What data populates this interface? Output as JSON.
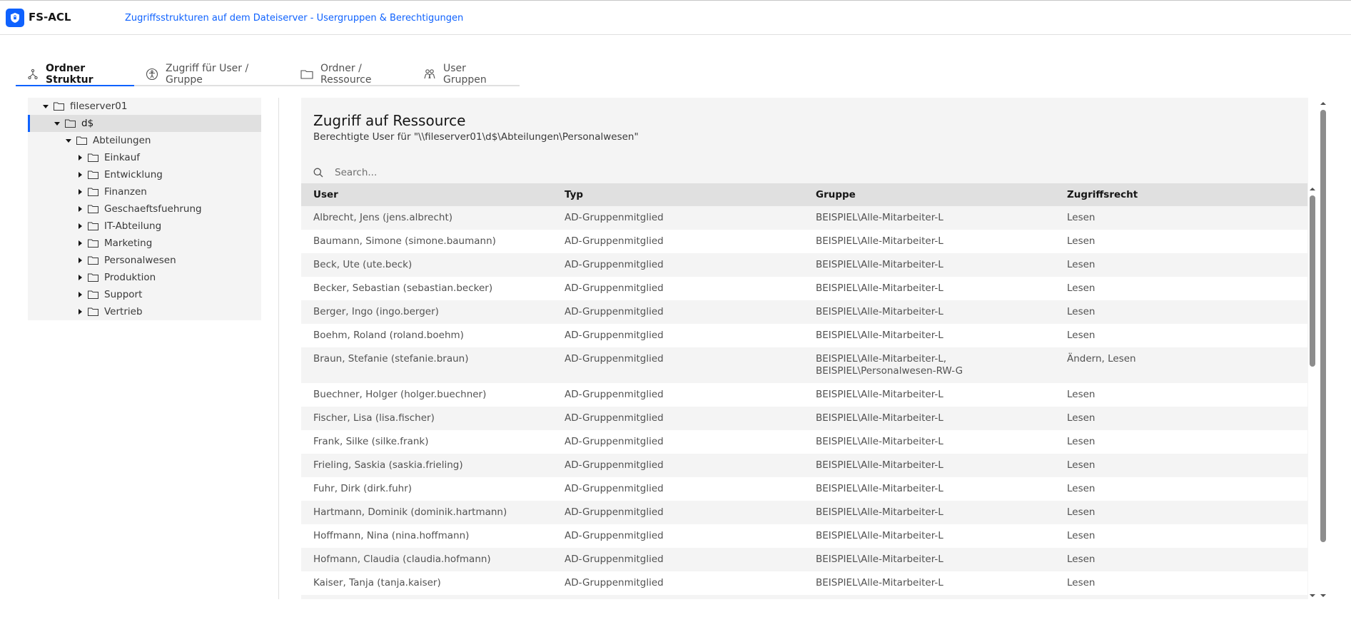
{
  "header": {
    "app_name": "FS-ACL",
    "subtitle": "Zugriffsstrukturen auf dem Dateiserver - Usergruppen & Berechtigungen",
    "brand_color": "#0f62fe"
  },
  "tabs": [
    {
      "label": "Ordner Struktur",
      "icon": "hierarchy-icon",
      "active": true
    },
    {
      "label": "Zugriff für User / Gruppe",
      "icon": "user-accessibility-icon",
      "active": false
    },
    {
      "label": "Ordner / Ressource",
      "icon": "folder-icon",
      "active": false
    },
    {
      "label": "User Gruppen",
      "icon": "user-group-icon",
      "active": false
    }
  ],
  "tree": {
    "items": [
      {
        "label": "fileserver01",
        "expanded": true,
        "level": 1
      },
      {
        "label": "d$",
        "expanded": true,
        "level": 2,
        "selected": true
      },
      {
        "label": "Abteilungen",
        "expanded": true,
        "level": 3
      },
      {
        "label": "Einkauf",
        "expanded": false,
        "level": 4
      },
      {
        "label": "Entwicklung",
        "expanded": false,
        "level": 4
      },
      {
        "label": "Finanzen",
        "expanded": false,
        "level": 4
      },
      {
        "label": "Geschaeftsfuehrung",
        "expanded": false,
        "level": 4
      },
      {
        "label": "IT-Abteilung",
        "expanded": false,
        "level": 4
      },
      {
        "label": "Marketing",
        "expanded": false,
        "level": 4
      },
      {
        "label": "Personalwesen",
        "expanded": false,
        "level": 4
      },
      {
        "label": "Produktion",
        "expanded": false,
        "level": 4
      },
      {
        "label": "Support",
        "expanded": false,
        "level": 4
      },
      {
        "label": "Vertrieb",
        "expanded": false,
        "level": 4
      }
    ]
  },
  "panel": {
    "title": "Zugriff auf Ressource",
    "description": "Berechtigte User für \"\\\\fileserver01\\d$\\Abteilungen\\Personalwesen\"",
    "search_placeholder": "Search...",
    "columns": [
      "User",
      "Typ",
      "Gruppe",
      "Zugriffsrecht"
    ],
    "rows": [
      [
        "Albrecht, Jens (jens.albrecht)",
        "AD-Gruppenmitglied",
        "BEISPIEL\\Alle-Mitarbeiter-L",
        "Lesen"
      ],
      [
        "Baumann, Simone (simone.baumann)",
        "AD-Gruppenmitglied",
        "BEISPIEL\\Alle-Mitarbeiter-L",
        "Lesen"
      ],
      [
        "Beck, Ute (ute.beck)",
        "AD-Gruppenmitglied",
        "BEISPIEL\\Alle-Mitarbeiter-L",
        "Lesen"
      ],
      [
        "Becker, Sebastian (sebastian.becker)",
        "AD-Gruppenmitglied",
        "BEISPIEL\\Alle-Mitarbeiter-L",
        "Lesen"
      ],
      [
        "Berger, Ingo (ingo.berger)",
        "AD-Gruppenmitglied",
        "BEISPIEL\\Alle-Mitarbeiter-L",
        "Lesen"
      ],
      [
        "Boehm, Roland (roland.boehm)",
        "AD-Gruppenmitglied",
        "BEISPIEL\\Alle-Mitarbeiter-L",
        "Lesen"
      ],
      [
        "Braun, Stefanie (stefanie.braun)",
        "AD-Gruppenmitglied",
        "BEISPIEL\\Alle-Mitarbeiter-L,\nBEISPIEL\\Personalwesen-RW-G",
        "Ändern, Lesen"
      ],
      [
        "Buechner, Holger (holger.buechner)",
        "AD-Gruppenmitglied",
        "BEISPIEL\\Alle-Mitarbeiter-L",
        "Lesen"
      ],
      [
        "Fischer, Lisa (lisa.fischer)",
        "AD-Gruppenmitglied",
        "BEISPIEL\\Alle-Mitarbeiter-L",
        "Lesen"
      ],
      [
        "Frank, Silke (silke.frank)",
        "AD-Gruppenmitglied",
        "BEISPIEL\\Alle-Mitarbeiter-L",
        "Lesen"
      ],
      [
        "Frieling, Saskia (saskia.frieling)",
        "AD-Gruppenmitglied",
        "BEISPIEL\\Alle-Mitarbeiter-L",
        "Lesen"
      ],
      [
        "Fuhr, Dirk (dirk.fuhr)",
        "AD-Gruppenmitglied",
        "BEISPIEL\\Alle-Mitarbeiter-L",
        "Lesen"
      ],
      [
        "Hartmann, Dominik (dominik.hartmann)",
        "AD-Gruppenmitglied",
        "BEISPIEL\\Alle-Mitarbeiter-L",
        "Lesen"
      ],
      [
        "Hoffmann, Nina (nina.hoffmann)",
        "AD-Gruppenmitglied",
        "BEISPIEL\\Alle-Mitarbeiter-L",
        "Lesen"
      ],
      [
        "Hofmann, Claudia (claudia.hofmann)",
        "AD-Gruppenmitglied",
        "BEISPIEL\\Alle-Mitarbeiter-L",
        "Lesen"
      ],
      [
        "Kaiser, Tanja (tanja.kaiser)",
        "AD-Gruppenmitglied",
        "BEISPIEL\\Alle-Mitarbeiter-L",
        "Lesen"
      ]
    ]
  }
}
